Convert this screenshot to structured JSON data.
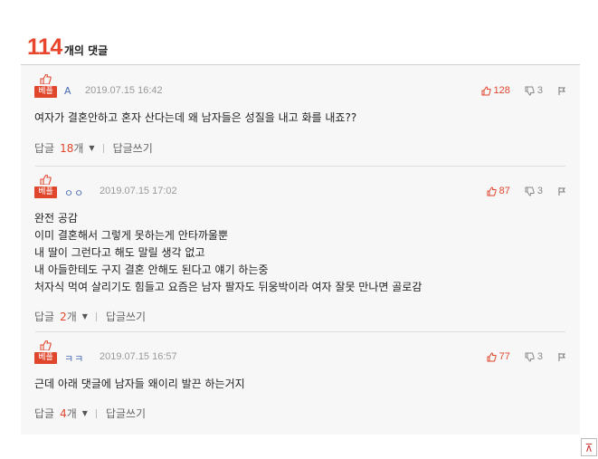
{
  "header": {
    "count": "114",
    "label": "개의 댓글"
  },
  "comments": [
    {
      "badge": "베플",
      "author": "A",
      "date": "2019.07.15 16:42",
      "likes": "128",
      "dislikes": "3",
      "lines": [
        "여자가 결혼안하고 혼자 산다는데 왜 남자들은 성질을 내고 화를 내죠??"
      ],
      "reply_label": "답글",
      "reply_count": "18",
      "reply_unit": "개",
      "write_label": "답글쓰기"
    },
    {
      "badge": "베플",
      "author": "ㅇㅇ",
      "date": "2019.07.15 17:02",
      "likes": "87",
      "dislikes": "3",
      "lines": [
        "완전 공감",
        "이미 결혼해서 그렇게 못하는게 안타까울뿐",
        "내 딸이 그런다고 해도 말릴 생각 없고",
        "내 아들한테도 구지 결혼 안해도 된다고 얘기 하는중",
        "처자식 먹여 살리기도 힘들고 요즘은 남자 팔자도 뒤웅박이라 여자 잘못 만나면 골로감"
      ],
      "reply_label": "답글",
      "reply_count": "2",
      "reply_unit": "개",
      "write_label": "답글쓰기"
    },
    {
      "badge": "베플",
      "author": "ㅋㅋ",
      "date": "2019.07.15 16:57",
      "likes": "77",
      "dislikes": "3",
      "lines": [
        "근데 아래 댓글에 남자들 왜이리 발끈 하는거지"
      ],
      "reply_label": "답글",
      "reply_count": "4",
      "reply_unit": "개",
      "write_label": "답글쓰기"
    }
  ],
  "icons": {
    "thumb": "thumbs-up-icon",
    "dislike": "thumbs-down-icon",
    "report": "report-icon",
    "caret": "caret-down-icon",
    "corner": "corner-icon"
  },
  "colors": {
    "accent": "#e0462c",
    "author": "#4a6bb3",
    "panel_bg": "#f7f7f7"
  },
  "corner_glyph": "⊼"
}
